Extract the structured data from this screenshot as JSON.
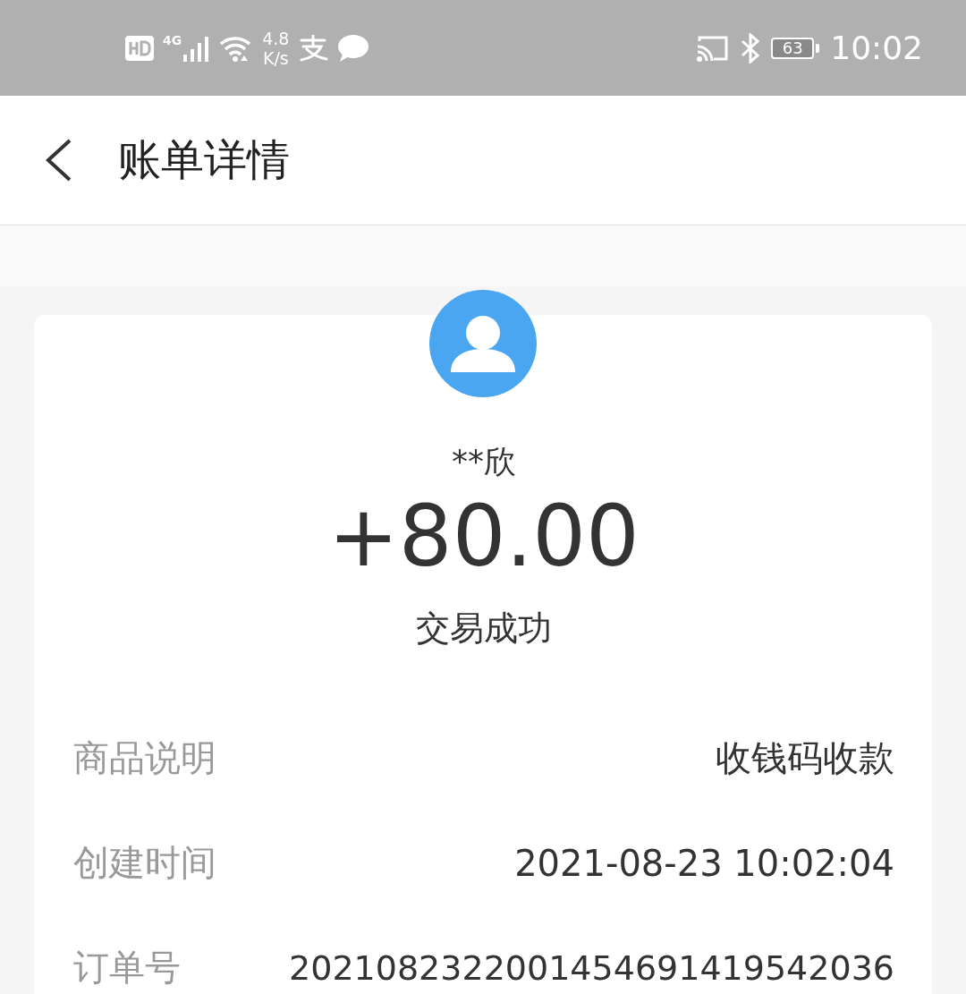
{
  "status_bar": {
    "network": "4G",
    "speed_value": "4.8",
    "speed_unit": "K/s",
    "battery": "63",
    "time": "10:02"
  },
  "header": {
    "title": "账单详情"
  },
  "transaction": {
    "name": "**欣",
    "amount": "+80.00",
    "status": "交易成功"
  },
  "details": [
    {
      "label": "商品说明",
      "value": "收钱码收款"
    },
    {
      "label": "创建时间",
      "value": "2021-08-23 10:02:04"
    },
    {
      "label": "订单号",
      "value": "2021082322001454691419542036"
    }
  ]
}
